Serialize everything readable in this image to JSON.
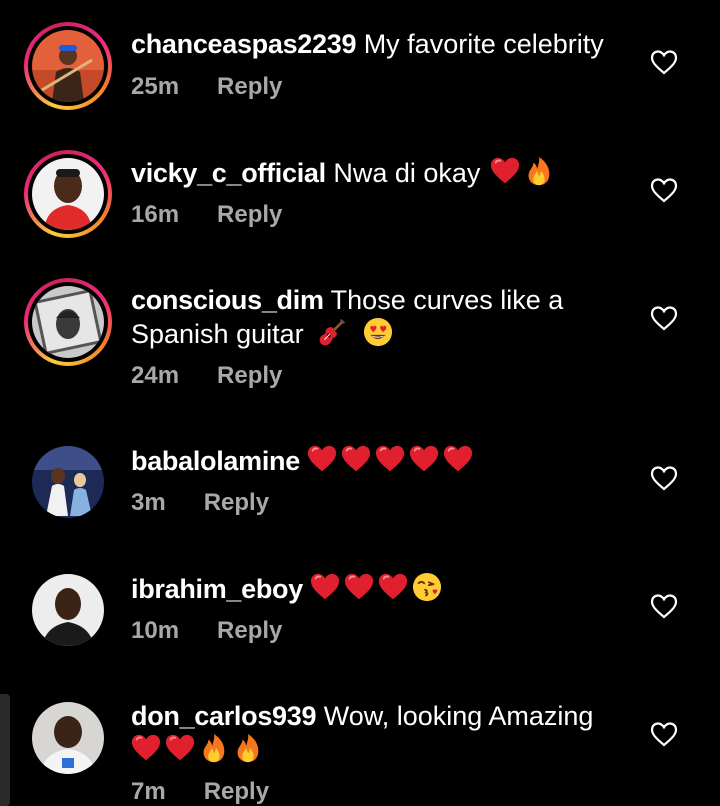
{
  "comments": [
    {
      "username": "chanceaspas2239",
      "text": "My favorite celebrity",
      "time": "25m",
      "reply": "Reply",
      "has_story_ring": true,
      "emojis": []
    },
    {
      "username": "vicky_c_official",
      "text": "Nwa di okay",
      "time": "16m",
      "reply": "Reply",
      "has_story_ring": true,
      "emojis": [
        "red-heart",
        "fire"
      ]
    },
    {
      "username": "conscious_dim",
      "text": "Those curves like a",
      "text_line2": "Spanish guitar",
      "time": "24m",
      "reply": "Reply",
      "has_story_ring": true,
      "emojis": [
        "guitar",
        "heart-eyes"
      ]
    },
    {
      "username": "babalolamine",
      "text": "",
      "time": "3m",
      "reply": "Reply",
      "has_story_ring": false,
      "emojis": [
        "red-heart",
        "red-heart",
        "red-heart",
        "red-heart",
        "red-heart"
      ]
    },
    {
      "username": "ibrahim_eboy",
      "text": "",
      "time": "10m",
      "reply": "Reply",
      "has_story_ring": false,
      "emojis": [
        "red-heart",
        "red-heart",
        "red-heart",
        "kissing-heart"
      ]
    },
    {
      "username": "don_carlos939",
      "text": "Wow, looking Amazing",
      "time": "7m",
      "reply": "Reply",
      "has_story_ring": false,
      "emojis": [
        "red-heart",
        "red-heart",
        "fire",
        "fire"
      ]
    }
  ],
  "colors": {
    "background": "#000000",
    "text": "#ffffff",
    "meta": "#a8a8a8",
    "heart_emoji": "#e0202e",
    "ring_start": "#f9ce34",
    "ring_end": "#ee2a7b"
  },
  "icons": {
    "like": "heart-outline-icon"
  }
}
